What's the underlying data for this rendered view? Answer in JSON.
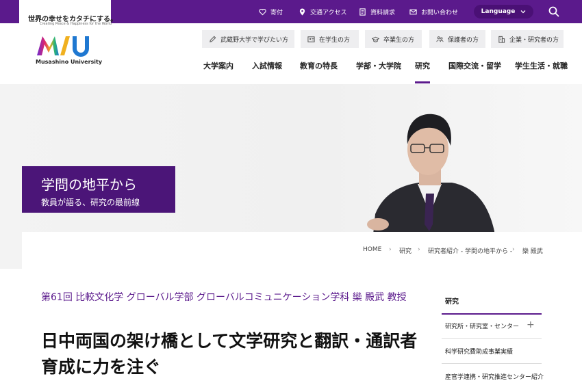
{
  "tagline": {
    "jp": "世界の幸せをカタチにする。",
    "en": "Creating Peace & Happiness for the World"
  },
  "utility": {
    "donate": "寄付",
    "access": "交通アクセス",
    "documents": "資料請求",
    "contact": "お問い合わせ",
    "language": "Language"
  },
  "logo": {
    "name": "Musashino University"
  },
  "audience": [
    {
      "label": "武蔵野大学で学びたい方",
      "icon": "pencil-icon"
    },
    {
      "label": "在学生の方",
      "icon": "student-card-icon"
    },
    {
      "label": "卒業生の方",
      "icon": "graduation-cap-icon"
    },
    {
      "label": "保護者の方",
      "icon": "parents-icon"
    },
    {
      "label": "企業・研究者の方",
      "icon": "building-icon"
    }
  ],
  "nav": [
    {
      "label": "大学案内"
    },
    {
      "label": "入試情報"
    },
    {
      "label": "教育の特長"
    },
    {
      "label": "学部・大学院"
    },
    {
      "label": "研究",
      "active": true
    },
    {
      "label": "国際交流・留学"
    },
    {
      "label": "学生生活・就職"
    }
  ],
  "hero": {
    "title": "学問の地平から",
    "subtitle": "教員が語る、研究の最前線"
  },
  "breadcrumb": [
    "HOME",
    "研究",
    "研究者紹介 - 学問の地平から -",
    "欒 殿武"
  ],
  "article": {
    "kicker": "第61回 比較文化学 グローバル学部 グローバルコミュニケーション学科 欒 殿武 教授",
    "headline": "日中両国の架け橋として文学研究と翻訳・通訳者育成に力を注ぐ"
  },
  "sidebar": {
    "heading": "研究",
    "items": [
      {
        "label": "研究所・研究室・センター"
      },
      {
        "label": "科学研究費助成事業実績"
      },
      {
        "label": "産官学連携・研究推進センター紹介"
      }
    ]
  },
  "colors": {
    "brand": "#5b1a8c",
    "hero_box": "#4b1578"
  }
}
